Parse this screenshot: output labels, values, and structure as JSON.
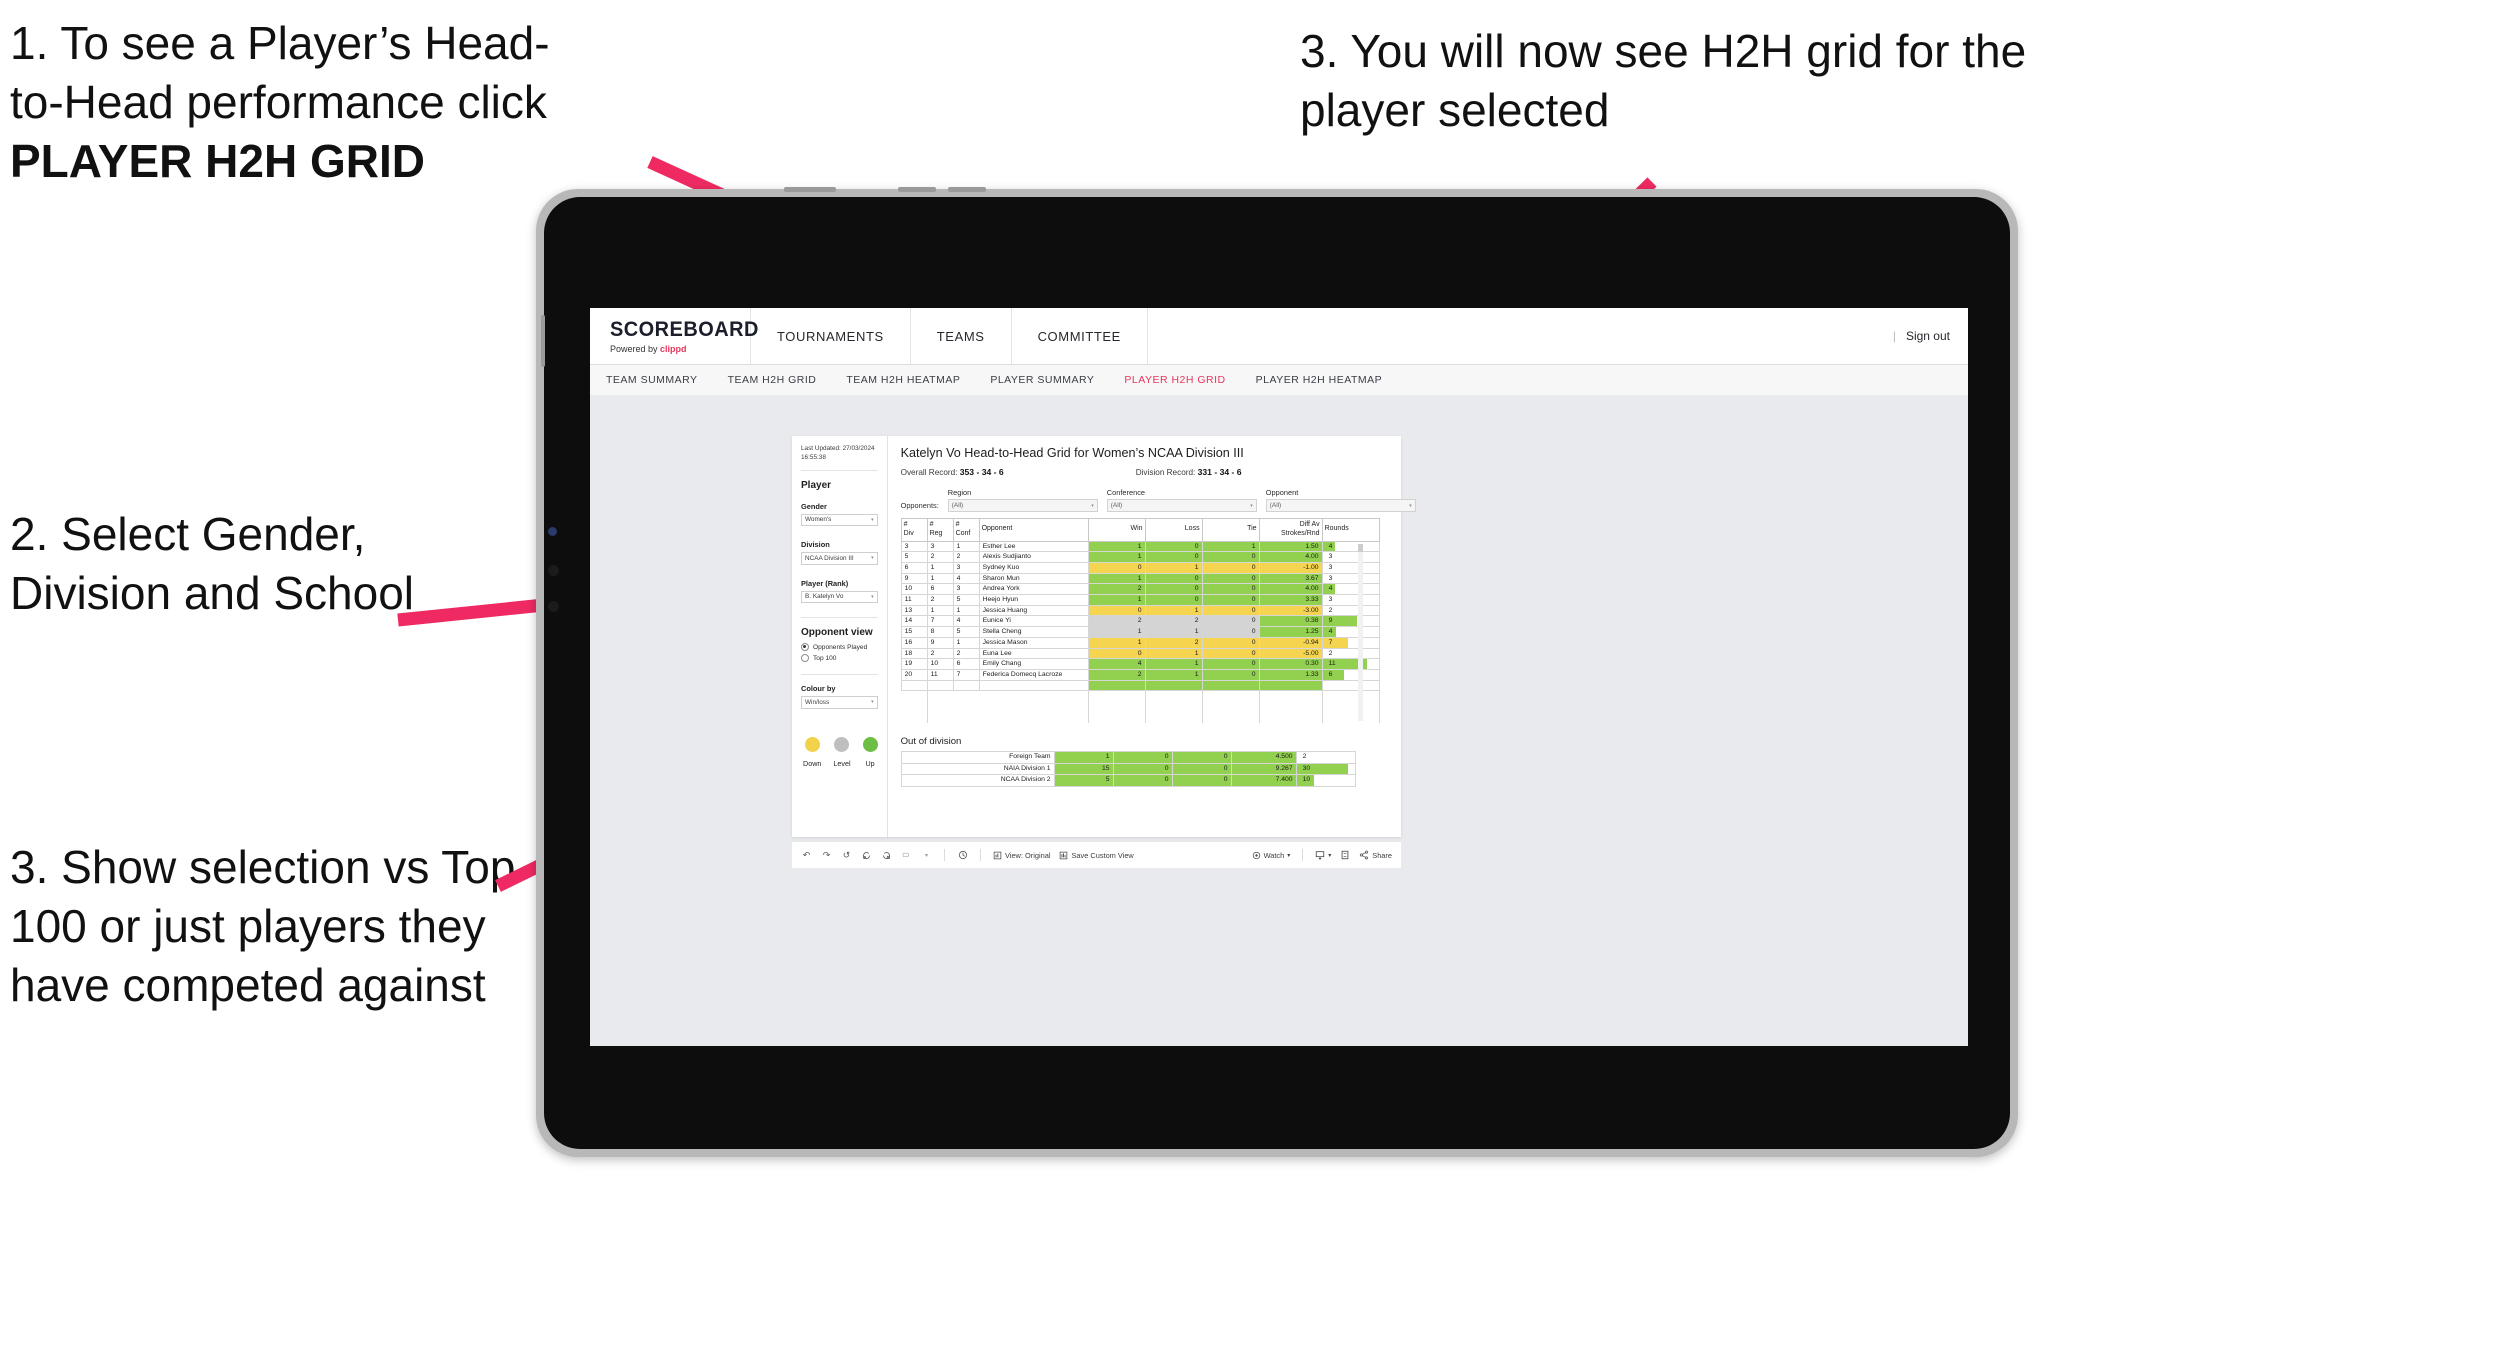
{
  "annotations": [
    {
      "id": "a1",
      "text_line1": "1. To see a Player’s Head-",
      "text_line2": "to-Head performance click",
      "text_bold": "PLAYER H2H GRID"
    },
    {
      "id": "a2",
      "text": "2. Select Gender, Division and School"
    },
    {
      "id": "a3",
      "text": "3. Show selection vs Top 100 or just players they have competed against"
    },
    {
      "id": "a4",
      "text": "3. You will now see H2H grid for the player selected"
    }
  ],
  "colors": {
    "accent": "#e8365d",
    "win_green": "#92d050",
    "loss_yellow": "#f5d44f",
    "level_grey": "#d4d4d4"
  },
  "app": {
    "logo": {
      "word": "SCOREBOARD",
      "powered_by": "Powered by",
      "brand": "clippd"
    },
    "header_nav": [
      "TOURNAMENTS",
      "TEAMS",
      "COMMITTEE"
    ],
    "header_right": {
      "separator": "|",
      "sign_out": "Sign out"
    },
    "tabs": [
      {
        "label": "TEAM SUMMARY",
        "active": false
      },
      {
        "label": "TEAM H2H GRID",
        "active": false
      },
      {
        "label": "TEAM H2H HEATMAP",
        "active": false
      },
      {
        "label": "PLAYER SUMMARY",
        "active": false
      },
      {
        "label": "PLAYER H2H GRID",
        "active": true
      },
      {
        "label": "PLAYER H2H HEATMAP",
        "active": false
      }
    ]
  },
  "filters": {
    "last_updated": "Last Updated: 27/03/2024 16:55:38",
    "section_title": "Player",
    "fields": [
      {
        "label": "Gender",
        "value": "Women's"
      },
      {
        "label": "Division",
        "value": "NCAA Division III"
      },
      {
        "label": "Player (Rank)",
        "value": "B. Katelyn Vo"
      }
    ],
    "opponent_view": {
      "title": "Opponent view",
      "options": [
        {
          "label": "Opponents Played",
          "selected": true
        },
        {
          "label": "Top 100",
          "selected": false
        }
      ]
    },
    "colour_by": {
      "label": "Colour by",
      "value": "Win/loss"
    },
    "legend": [
      {
        "label": "Down",
        "color": "#f2d14b"
      },
      {
        "label": "Level",
        "color": "#bfbfbf"
      },
      {
        "label": "Up",
        "color": "#6cbe45"
      }
    ]
  },
  "view": {
    "title": "Katelyn Vo Head-to-Head Grid for Women’s NCAA Division III",
    "overall_record_label": "Overall Record:",
    "overall_record_value": "353 - 34 - 6",
    "division_record_label": "Division Record:",
    "division_record_value": "331 - 34 - 6",
    "opponents_label": "Opponents:",
    "opponent_filters": [
      {
        "label": "Region",
        "value": "(All)"
      },
      {
        "label": "Conference",
        "value": "(All)"
      },
      {
        "label": "Opponent",
        "value": "(All)"
      }
    ]
  },
  "chart_data": {
    "type": "table",
    "title": "Katelyn Vo Head-to-Head Grid for Women’s NCAA Division III",
    "columns": [
      "# Div",
      "# Reg",
      "# Conf",
      "Opponent",
      "Win",
      "Loss",
      "Tie",
      "Diff Av Strokes/Rnd",
      "Rounds"
    ],
    "column_headers_multiline": [
      [
        "#",
        "Div"
      ],
      [
        "#",
        "Reg"
      ],
      [
        "#",
        "Conf"
      ],
      [
        "Opponent"
      ],
      [
        "Win"
      ],
      [
        "Loss"
      ],
      [
        "Tie"
      ],
      [
        "Diff Av",
        "Strokes/Rnd"
      ],
      [
        "Rounds"
      ]
    ],
    "rows": [
      {
        "div": "3",
        "reg": "3",
        "conf": "1",
        "opponent": "Esther Lee",
        "win": "1",
        "loss": "0",
        "tie": "1",
        "diff": "1.50",
        "rounds": "4",
        "color": "green",
        "bar_pct": 22
      },
      {
        "div": "5",
        "reg": "2",
        "conf": "2",
        "opponent": "Alexis Sudjianto",
        "win": "1",
        "loss": "0",
        "tie": "0",
        "diff": "4.00",
        "rounds": "3",
        "color": "green",
        "bar_pct": 0
      },
      {
        "div": "6",
        "reg": "1",
        "conf": "3",
        "opponent": "Sydney Kuo",
        "win": "0",
        "loss": "1",
        "tie": "0",
        "diff": "-1.00",
        "rounds": "3",
        "color": "yellow",
        "bar_pct": 0
      },
      {
        "div": "9",
        "reg": "1",
        "conf": "4",
        "opponent": "Sharon Mun",
        "win": "1",
        "loss": "0",
        "tie": "0",
        "diff": "3.67",
        "rounds": "3",
        "color": "green",
        "bar_pct": 0
      },
      {
        "div": "10",
        "reg": "6",
        "conf": "3",
        "opponent": "Andrea York",
        "win": "2",
        "loss": "0",
        "tie": "0",
        "diff": "4.00",
        "rounds": "4",
        "color": "green",
        "bar_pct": 22
      },
      {
        "div": "11",
        "reg": "2",
        "conf": "5",
        "opponent": "Heejo Hyun",
        "win": "1",
        "loss": "0",
        "tie": "0",
        "diff": "3.33",
        "rounds": "3",
        "color": "green",
        "bar_pct": 0
      },
      {
        "div": "13",
        "reg": "1",
        "conf": "1",
        "opponent": "Jessica Huang",
        "win": "0",
        "loss": "1",
        "tie": "0",
        "diff": "-3.00",
        "rounds": "2",
        "color": "yellow",
        "bar_pct": 0
      },
      {
        "div": "14",
        "reg": "7",
        "conf": "4",
        "opponent": "Eunice Yi",
        "win": "2",
        "loss": "2",
        "tie": "0",
        "diff": "0.38",
        "rounds": "9",
        "color": "grey",
        "diff_color": "green",
        "bar_pct": 62
      },
      {
        "div": "15",
        "reg": "8",
        "conf": "5",
        "opponent": "Stella Cheng",
        "win": "1",
        "loss": "1",
        "tie": "0",
        "diff": "1.25",
        "rounds": "4",
        "color": "grey",
        "diff_color": "green",
        "bar_pct": 24
      },
      {
        "div": "16",
        "reg": "9",
        "conf": "1",
        "opponent": "Jessica Mason",
        "win": "1",
        "loss": "2",
        "tie": "0",
        "diff": "-0.94",
        "rounds": "7",
        "color": "yellow",
        "bar_pct": 46
      },
      {
        "div": "18",
        "reg": "2",
        "conf": "2",
        "opponent": "Euna Lee",
        "win": "0",
        "loss": "1",
        "tie": "0",
        "diff": "-5.00",
        "rounds": "2",
        "color": "yellow",
        "bar_pct": 0
      },
      {
        "div": "19",
        "reg": "10",
        "conf": "6",
        "opponent": "Emily Chang",
        "win": "4",
        "loss": "1",
        "tie": "0",
        "diff": "0.30",
        "rounds": "11",
        "color": "green",
        "bar_pct": 80
      },
      {
        "div": "20",
        "reg": "11",
        "conf": "7",
        "opponent": "Federica Domecq Lacroze",
        "win": "2",
        "loss": "1",
        "tie": "0",
        "diff": "1.33",
        "rounds": "6",
        "color": "green",
        "bar_pct": 38
      }
    ],
    "out_of_division": {
      "title": "Out of division",
      "rows": [
        {
          "name": "Foreign Team",
          "win": "1",
          "loss": "0",
          "tie": "0",
          "diff": "4.500",
          "rounds": "2",
          "color": "green",
          "bar_pct": 0
        },
        {
          "name": "NAIA Division 1",
          "win": "15",
          "loss": "0",
          "tie": "0",
          "diff": "9.267",
          "rounds": "30",
          "color": "green",
          "bar_pct": 88
        },
        {
          "name": "NCAA Division 2",
          "win": "5",
          "loss": "0",
          "tie": "0",
          "diff": "7.400",
          "rounds": "10",
          "color": "green",
          "bar_pct": 30
        }
      ]
    }
  },
  "toolbar": {
    "icons": [
      "undo-icon",
      "redo-icon",
      "revert-icon",
      "refresh-icon",
      "pause-icon",
      "flag-icon",
      "dropdown-caret-icon",
      "clock-icon"
    ],
    "view_original": "View: Original",
    "save_custom_view": "Save Custom View",
    "watch": "Watch",
    "share": "Share"
  }
}
